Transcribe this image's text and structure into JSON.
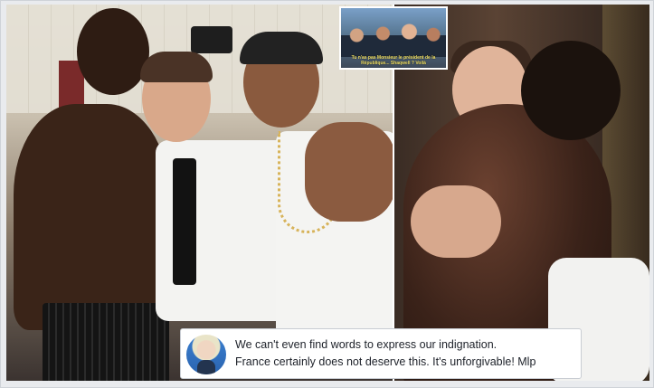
{
  "inset": {
    "caption": "Tu n'as pas Monsieur le président de la République... Shaqwell ? Voilà"
  },
  "comment": {
    "line1": "We can't even find words to express our indignation.",
    "line2": "France certainly does not deserve this. It's unforgivable! Mlp"
  }
}
